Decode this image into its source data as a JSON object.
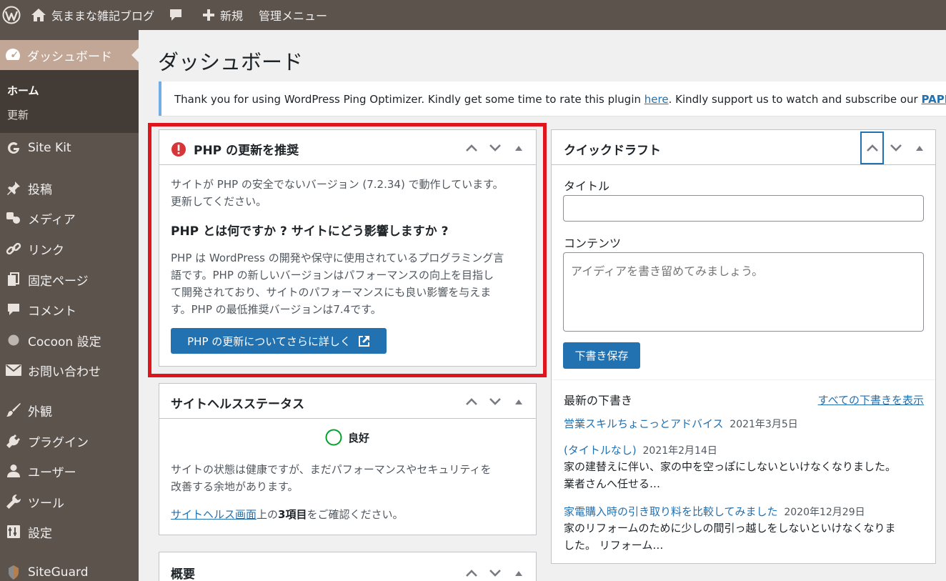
{
  "adminbar": {
    "site_name": "気ままな雑記ブログ",
    "new_label": "新規",
    "admin_menu_label": "管理メニュー",
    "icons": [
      "wordpress-logo-icon",
      "home-icon",
      "comment-bubble-icon",
      "plus-icon"
    ]
  },
  "sidebar": {
    "dashboard": "ダッシュボード",
    "submenu": [
      "ホーム",
      "更新"
    ],
    "items": [
      {
        "label": "Site Kit",
        "icon": "google-g-icon"
      },
      {
        "label": "投稿",
        "icon": "pin-icon"
      },
      {
        "label": "メディア",
        "icon": "media-icon"
      },
      {
        "label": "リンク",
        "icon": "link-icon"
      },
      {
        "label": "固定ページ",
        "icon": "pages-icon"
      },
      {
        "label": "コメント",
        "icon": "comment-icon"
      },
      {
        "label": "Cocoon 設定",
        "icon": "circle-icon"
      },
      {
        "label": "お問い合わせ",
        "icon": "mail-icon"
      },
      {
        "label": "外観",
        "icon": "brush-icon"
      },
      {
        "label": "プラグイン",
        "icon": "plugin-icon"
      },
      {
        "label": "ユーザー",
        "icon": "user-icon"
      },
      {
        "label": "ツール",
        "icon": "wrench-icon"
      },
      {
        "label": "設定",
        "icon": "settings-icon"
      },
      {
        "label": "SiteGuard",
        "icon": "siteguard-icon"
      }
    ]
  },
  "page": {
    "title": "ダッシュボード",
    "notice": {
      "text_before": "Thank you for using WordPress Ping Optimizer. Kindly get some time to rate this plugin ",
      "link_here": "here",
      "text_after": ". Kindly support us to watch and subscribe our ",
      "link_paper": "PAPER ORIGAMI"
    }
  },
  "php_box": {
    "title": "PHP の更新を推奨",
    "line1": "サイトが PHP の安全でないバージョン (7.2.34) で動作しています。",
    "line2": "更新してください。",
    "subheading": "PHP とは何ですか ? サイトにどう影響しますか ?",
    "desc": [
      "PHP は WordPress の開発や保守に使用されているプログラミング言",
      "語です。PHP の新しいバージョンはパフォーマンスの向上を目指し",
      "て開発されており、サイトのパフォーマンスにも良い影響を与えま",
      "す。PHP の最低推奨バージョンは7.4です。"
    ],
    "button": "PHP の更新についてさらに詳しく"
  },
  "health_box": {
    "title": "サイトヘルスステータス",
    "status": "良好",
    "line1": "サイトの状態は健康ですが、まだパフォーマンスやセキュリティを",
    "line2": "改善する余地があります。",
    "link": "サイトヘルス画面",
    "after_link": "上の",
    "count": "3項目",
    "end": "をご確認ください。"
  },
  "overview_box": {
    "title": "概要"
  },
  "quickdraft": {
    "title": "クイックドラフト",
    "title_label": "タイトル",
    "title_value": "",
    "content_label": "コンテンツ",
    "content_placeholder": "アイディアを書き留めてみましょう。",
    "save_button": "下書き保存",
    "recent_heading": "最新の下書き",
    "view_all": "すべての下書きを表示",
    "drafts": [
      {
        "title": "営業スキルちょこっとアドバイス",
        "date": "2021年3月5日",
        "excerpt": []
      },
      {
        "title": "(タイトルなし)",
        "date": "2021年2月14日",
        "excerpt": [
          "家の建替えに伴い、家の中を空っぽにしないといけなくなりました。",
          "業者さんへ任せる…"
        ]
      },
      {
        "title": "家電購入時の引き取り料を比較してみました",
        "date": "2020年12月29日",
        "excerpt": [
          "家のリフォームのために少しの間引っ越しをしないといけなくなりま",
          "した。 リフォーム…"
        ]
      }
    ]
  },
  "colors": {
    "adminbar": "#5d534d",
    "menu_active": "#c3a796",
    "submenu": "#433b35",
    "accent": "#2271b1",
    "highlight": "#e0141d",
    "good": "#00a32a",
    "error": "#d63638"
  }
}
